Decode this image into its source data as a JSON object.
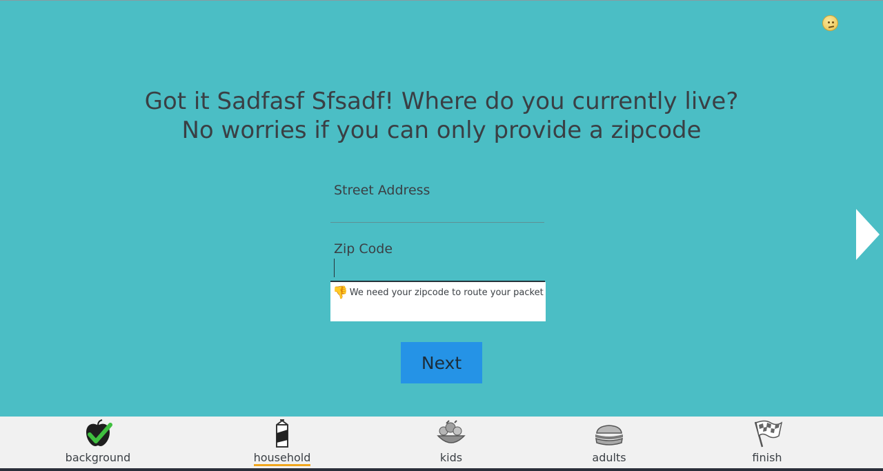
{
  "heading": {
    "line1": "Got it Sadfasf Sfsadf! Where do you currently live?",
    "line2": "No worries if you can only provide a zipcode"
  },
  "form": {
    "street_label": "Street Address",
    "street_value": "",
    "zip_label": "Zip Code",
    "zip_value": "",
    "error_message": "We need your zipcode to route your packet",
    "error_icon": "thumbs-down-icon"
  },
  "next_button": {
    "label": "Next"
  },
  "status_icon": "confused-face-icon",
  "nav": {
    "active": "household",
    "items": [
      {
        "id": "background",
        "label": "background",
        "icon": "apple-check-icon"
      },
      {
        "id": "household",
        "label": "household",
        "icon": "milk-carton-icon"
      },
      {
        "id": "kids",
        "label": "kids",
        "icon": "salad-bowl-icon"
      },
      {
        "id": "adults",
        "label": "adults",
        "icon": "sandwich-icon"
      },
      {
        "id": "finish",
        "label": "finish",
        "icon": "checkered-flag-icon"
      }
    ]
  },
  "colors": {
    "background": "#4bbec5",
    "button": "#2593e6",
    "active_underline": "#f0a51c",
    "nav_background": "#f1f1f1"
  }
}
